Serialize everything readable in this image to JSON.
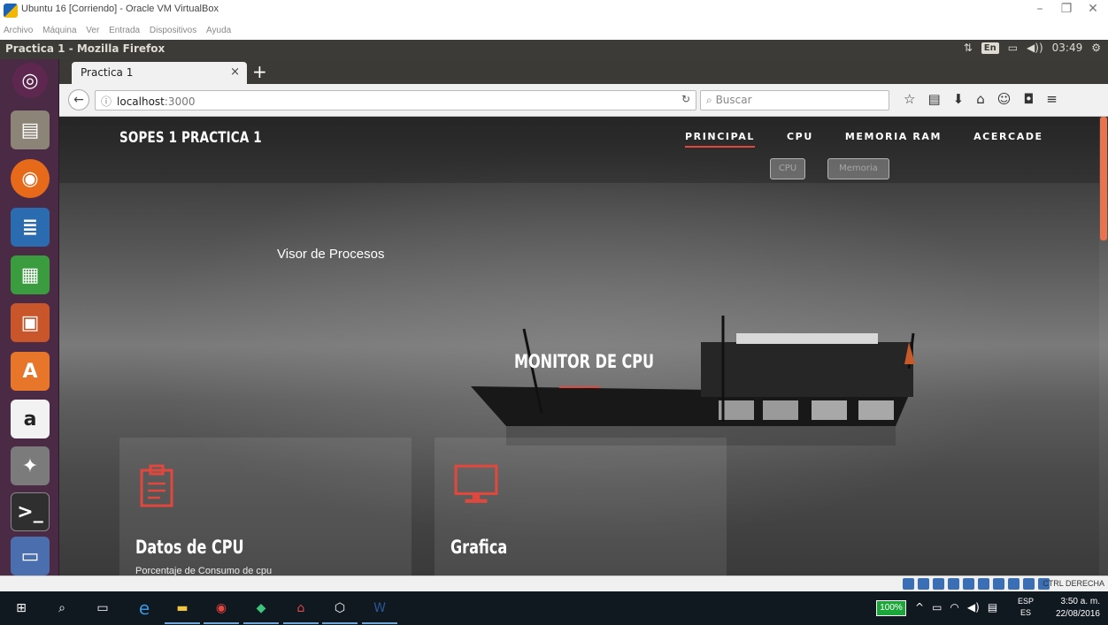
{
  "host_window": {
    "title": "Ubuntu 16 [Corriendo] - Oracle VM VirtualBox",
    "menu": [
      "Archivo",
      "Máquina",
      "Ver",
      "Entrada",
      "Dispositivos",
      "Ayuda"
    ],
    "controls": [
      "–",
      "❐",
      "✕"
    ],
    "host_key": "CTRL DERECHA"
  },
  "ubuntu_panel": {
    "window_title": "Practica 1 - Mozilla Firefox",
    "input_lang": "En",
    "time": "03:49"
  },
  "browser": {
    "tab_title": "Practica 1",
    "tab_close": "×",
    "new_tab": "+",
    "url_host": "localhost",
    "url_port": ":3000",
    "search_placeholder": "Buscar"
  },
  "site": {
    "brand": "SOPES 1 PRACTICA 1",
    "nav": [
      "PRINCIPAL",
      "CPU",
      "MEMORIA RAM",
      "ACERCADE"
    ],
    "sub_buttons": [
      "CPU",
      "Memoria"
    ],
    "visor_label": "Visor de Procesos",
    "hero_title": "MONITOR DE CPU",
    "cards": [
      {
        "title": "Datos de CPU",
        "subtitle": "Porcentaje de Consumo de cpu",
        "icon": "clipboard-icon"
      },
      {
        "title": "Grafica",
        "subtitle": "",
        "icon": "monitor-icon"
      }
    ],
    "accent": "#e0483e"
  },
  "taskbar": {
    "battery": "100%",
    "lang_top": "ESP",
    "lang_bottom": "ES",
    "time": "3:50 a. m.",
    "date": "22/08/2016"
  }
}
